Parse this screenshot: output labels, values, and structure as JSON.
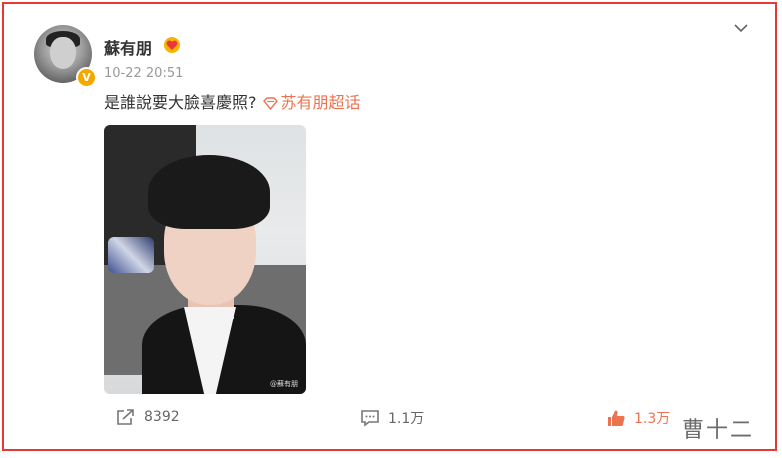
{
  "post": {
    "author": "蘇有朋",
    "time": "10-22 20:51",
    "text": "是誰說要大臉喜慶照?",
    "topic": "苏有朋超话",
    "photo_watermark": "@蘇有朋"
  },
  "actions": {
    "repost_count": "8392",
    "comment_count": "1.1万",
    "like_count": "1.3万"
  },
  "overlay_watermark": "曹十二",
  "colors": {
    "accent": "#eb7350",
    "frame": "#e53935",
    "verified": "#f3a800"
  },
  "icons": [
    "verified-icon",
    "fan-badge-icon",
    "chevron-down-icon",
    "supertopic-diamond-icon",
    "repost-icon",
    "comment-icon",
    "like-icon"
  ]
}
